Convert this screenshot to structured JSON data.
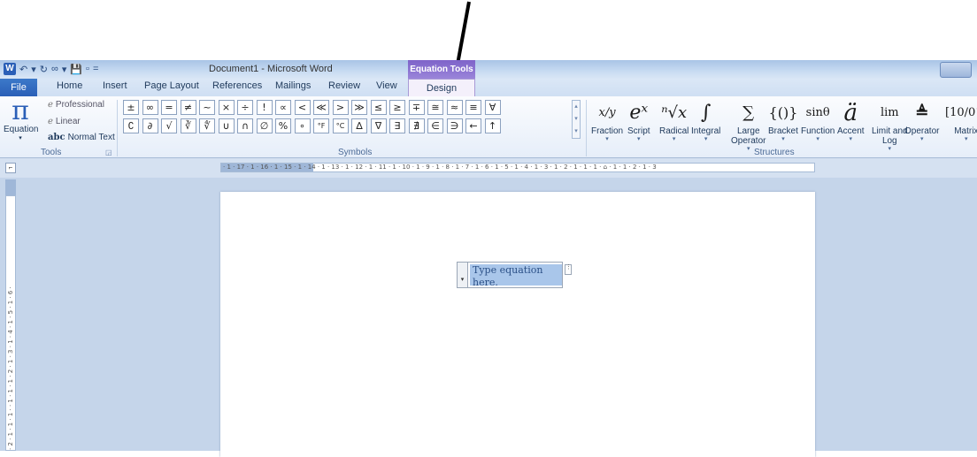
{
  "window": {
    "title": "Document1  -  Microsoft Word",
    "context_group": "Equation Tools",
    "qat_items": [
      "W",
      "↶",
      "▾",
      "↻",
      "∞",
      "▾",
      "💾",
      "▫",
      "="
    ]
  },
  "tabs": {
    "file": "File",
    "items": [
      "Home",
      "Insert",
      "Page Layout",
      "References",
      "Mailings",
      "Review",
      "View"
    ],
    "design": "Design"
  },
  "tools": {
    "equation_label": "Equation",
    "professional": "Professional",
    "linear": "Linear",
    "normal_text": "Normal Text",
    "normal_text_icon": "abc",
    "group_label": "Tools"
  },
  "symbols": {
    "group_label": "Symbols",
    "items": [
      "±",
      "∞",
      "=",
      "≠",
      "~",
      "×",
      "÷",
      "!",
      "∝",
      "<",
      "≪",
      ">",
      "≫",
      "≤",
      "≥",
      "∓",
      "≅",
      "≈",
      "≡",
      "∀",
      "",
      "∁",
      "∂",
      "√",
      "∛",
      "∜",
      "∪",
      "∩",
      "∅",
      "%",
      "∘",
      "°F",
      "°C",
      "∆",
      "∇",
      "∃",
      "∄",
      "∈",
      "∋",
      "←",
      "↑",
      ""
    ]
  },
  "structures": {
    "group_label": "Structures",
    "items": [
      {
        "label": "Fraction",
        "glyph": "x/y",
        "dropdown": true
      },
      {
        "label": "Script",
        "glyph": "eˣ",
        "dropdown": true
      },
      {
        "label": "Radical",
        "glyph": "ⁿ√x",
        "dropdown": true
      },
      {
        "label": "Integral",
        "glyph": "∫",
        "dropdown": true
      },
      {
        "label": "Large",
        "label2": "Operator",
        "glyph": "∑",
        "dropdown": true
      },
      {
        "label": "Bracket",
        "glyph": "{()}",
        "dropdown": true
      },
      {
        "label": "Function",
        "glyph": "sinθ",
        "dropdown": true
      },
      {
        "label": "Accent",
        "glyph": "ä",
        "dropdown": true
      },
      {
        "label": "Limit and",
        "label2": "Log",
        "glyph": "lim",
        "dropdown": true
      },
      {
        "label": "Operator",
        "glyph": "≜",
        "dropdown": true
      },
      {
        "label": "Matrix",
        "glyph": "[10/01]",
        "dropdown": true
      }
    ]
  },
  "ruler": {
    "horizontal": "· 1 · 17 · 1 · 16 · 1 · 15 · 1 · 14 · 1 · 13 · 1 · 12 · 1 · 11 · 1 · 10 · 1 · 9 · 1 · 8 · 1 · 7 · 1 · 6 · 1 · 5 · 1 · 4 · 1 · 3 · 1 · 2 · 1 · 1 · 1 · ⌂ · 1 · 1 · 2 · 1 · 3",
    "vertical": "· 2 · 1 · 1 · 1 · · 1 · 1 · 1 · 2 · 1 · 3 · 1 · 4 · 1 · 5 · 1 · 6 ·"
  },
  "document": {
    "equation_placeholder": "Type equation here."
  }
}
